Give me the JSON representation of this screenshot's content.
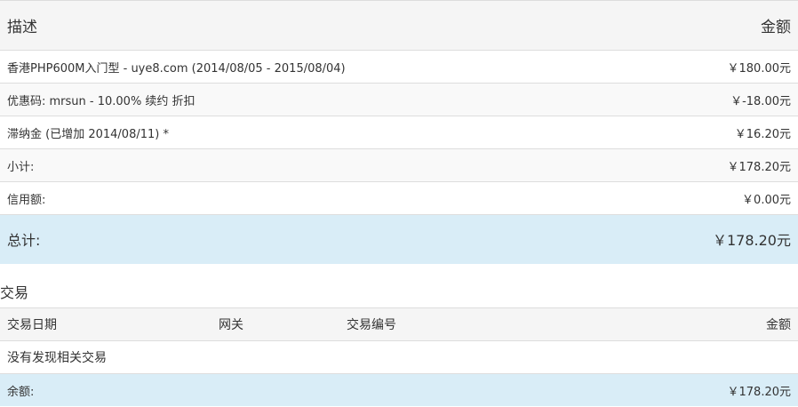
{
  "invoice_items": {
    "header": {
      "description": "描述",
      "amount": "金额"
    },
    "rows": [
      {
        "description": "香港PHP600M入门型 - uye8.com (2014/08/05 - 2015/08/04)",
        "amount": "￥180.00元"
      },
      {
        "description": "优惠码: mrsun - 10.00% 续约 折扣",
        "amount": "￥-18.00元"
      },
      {
        "description": "滞纳金 (已增加 2014/08/11) *",
        "amount": "￥16.20元"
      },
      {
        "description": "小计:",
        "amount": "￥178.20元"
      },
      {
        "description": "信用额:",
        "amount": "￥0.00元"
      }
    ],
    "total": {
      "label": "总计:",
      "amount": "￥178.20元"
    }
  },
  "transactions": {
    "title": "交易",
    "columns": {
      "date": "交易日期",
      "gateway": "网关",
      "transaction_id": "交易编号",
      "amount": "金额"
    },
    "empty_message": "没有发现相关交易",
    "balance": {
      "label": "余额:",
      "amount": "￥178.20元"
    }
  }
}
